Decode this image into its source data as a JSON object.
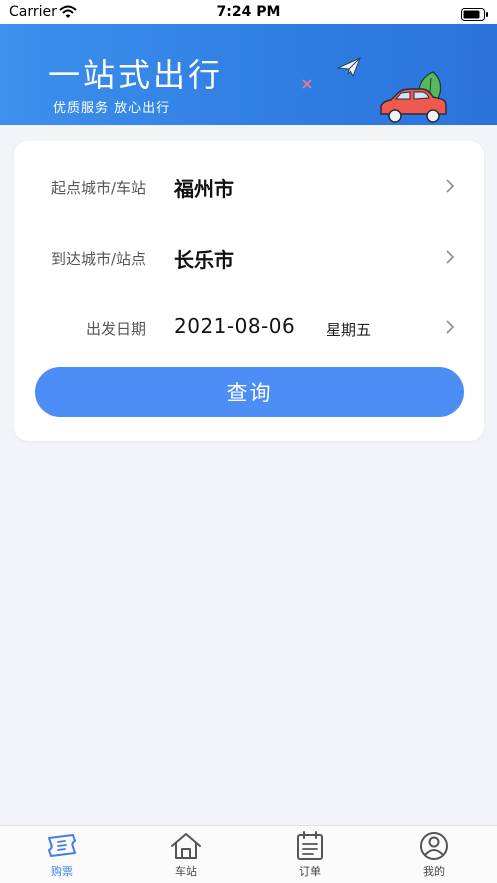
{
  "status_bar": {
    "carrier": "Carrier",
    "time": "7:24 PM"
  },
  "banner": {
    "title": "一站式出行",
    "subtitle": "优质服务  放心出行"
  },
  "form": {
    "origin": {
      "label": "起点城市/车站",
      "value": "福州市"
    },
    "destination": {
      "label": "到达城市/站点",
      "value": "长乐市"
    },
    "date": {
      "label": "出发日期",
      "value": "2021-08-06",
      "weekday": "星期五"
    },
    "search_label": "查询"
  },
  "tabs": [
    {
      "label": "购票",
      "icon": "ticket-icon",
      "active": true
    },
    {
      "label": "车站",
      "icon": "home-icon",
      "active": false
    },
    {
      "label": "订单",
      "icon": "clipboard-icon",
      "active": false
    },
    {
      "label": "我的",
      "icon": "user-icon",
      "active": false
    }
  ],
  "colors": {
    "accent": "#4c8ef5",
    "banner": "#2f7fe3",
    "active_tab": "#3f7fe6",
    "background": "#f3f4f7"
  }
}
